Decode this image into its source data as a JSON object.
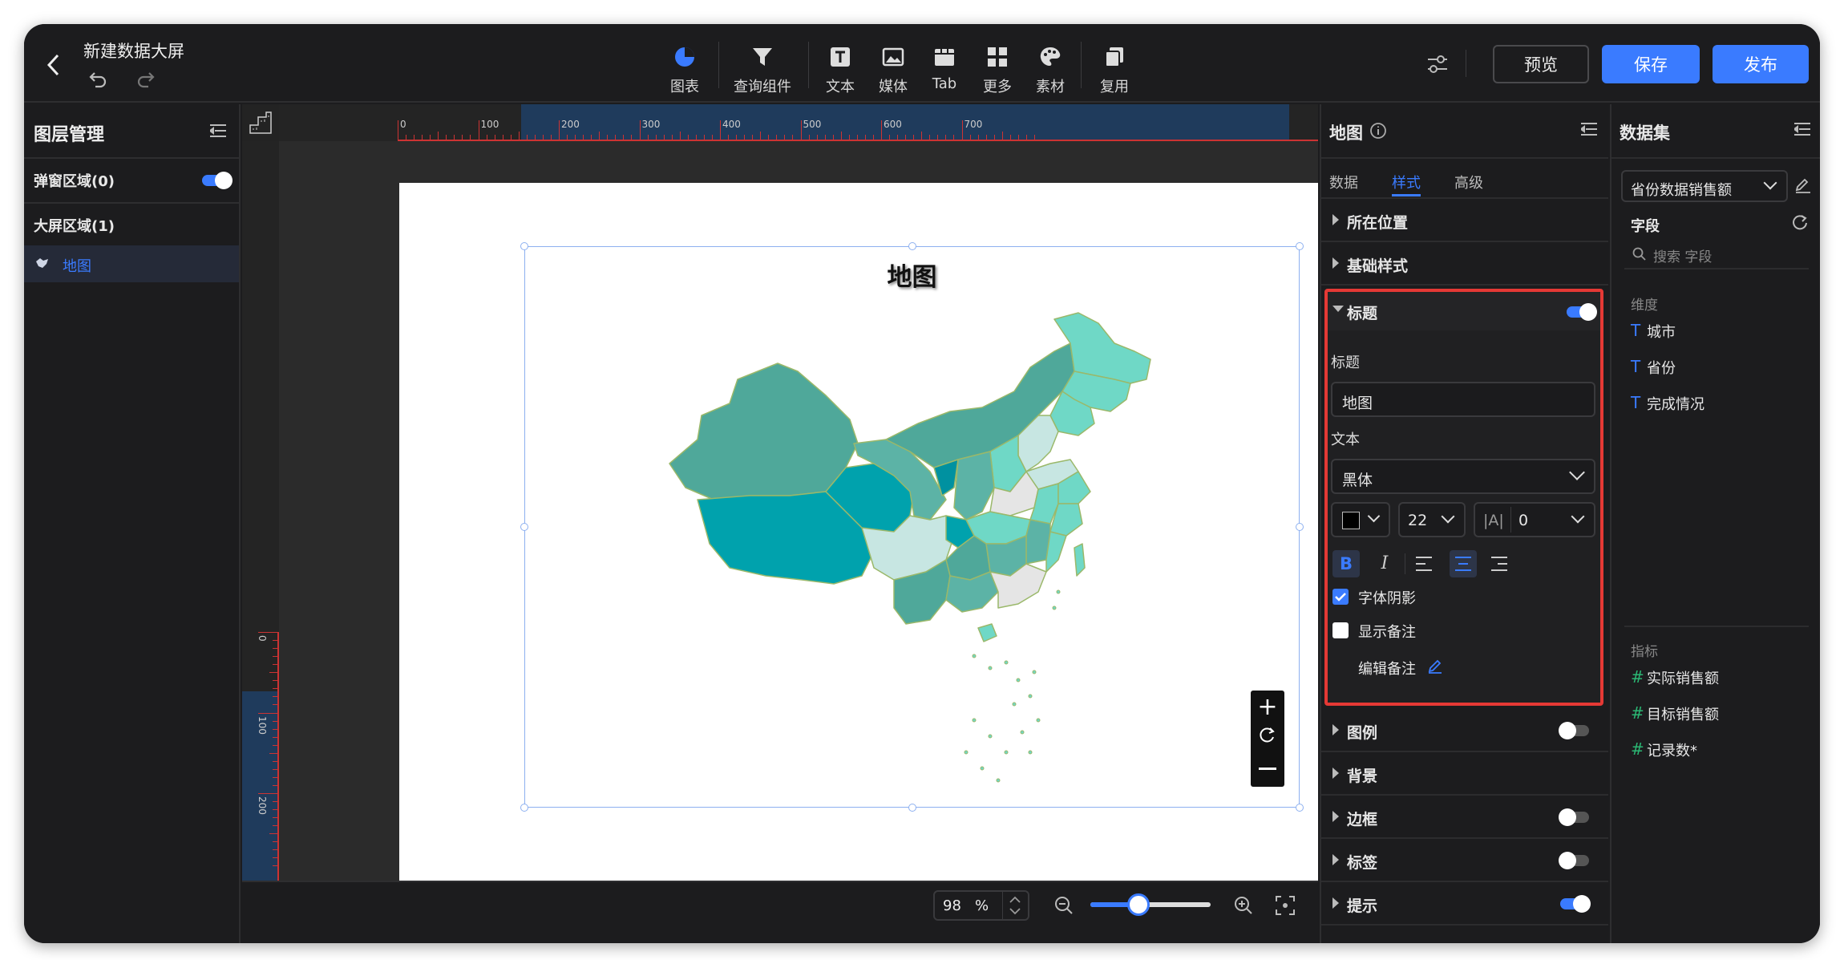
{
  "header": {
    "title": "新建数据大屏",
    "settings_icon": "sliders-icon",
    "preview_label": "预览",
    "save_label": "保存",
    "publish_label": "发布"
  },
  "toolbar": [
    {
      "label": "图表",
      "icon": "pie-chart-icon"
    },
    {
      "label": "查询组件",
      "icon": "filter-icon"
    },
    {
      "label": "文本",
      "icon": "text-icon"
    },
    {
      "label": "媒体",
      "icon": "image-icon"
    },
    {
      "label": "Tab",
      "icon": "tab-icon"
    },
    {
      "label": "更多",
      "icon": "grid-icon"
    },
    {
      "label": "素材",
      "icon": "palette-icon"
    },
    {
      "label": "复用",
      "icon": "copy-icon"
    }
  ],
  "layers": {
    "title": "图层管理",
    "popup_area": "弹窗区域(0)",
    "screen_area": "大屏区域(1)",
    "items": [
      {
        "label": "地图",
        "icon": "map-icon"
      }
    ]
  },
  "ruler": {
    "h_ticks": [
      "0",
      "100",
      "200",
      "300",
      "400",
      "500",
      "600",
      "700"
    ],
    "v_ticks": [
      "0",
      "100",
      "200"
    ]
  },
  "canvas": {
    "map_title": "地图"
  },
  "zoom": {
    "value": "98",
    "unit": "%",
    "level": 0.4
  },
  "style_panel": {
    "title": "地图",
    "tabs": [
      "数据",
      "样式",
      "高级"
    ],
    "active_tab": "样式",
    "sections_top": [
      "所在位置",
      "基础样式"
    ],
    "title_section": {
      "label": "标题",
      "enabled": true,
      "title_label": "标题",
      "title_value": "地图",
      "text_label": "文本",
      "font_value": "黑体",
      "font_size": "22",
      "letter_spacing": "0",
      "shadow_label": "字体阴影",
      "shadow_checked": true,
      "note_label": "显示备注",
      "note_checked": false,
      "edit_note_label": "编辑备注"
    },
    "sections_bottom": [
      {
        "label": "图例",
        "toggle": false
      },
      {
        "label": "背景",
        "toggle": null
      },
      {
        "label": "边框",
        "toggle": false
      },
      {
        "label": "标签",
        "toggle": false
      },
      {
        "label": "提示",
        "toggle": true
      }
    ]
  },
  "dataset": {
    "title": "数据集",
    "selected": "省份数据销售额",
    "fields_label": "字段",
    "search_placeholder": "搜索 字段",
    "dimensions_label": "维度",
    "dimensions": [
      "城市",
      "省份",
      "完成情况"
    ],
    "measures_label": "指标",
    "measures": [
      "实际销售额",
      "目标销售额",
      "记录数*"
    ]
  },
  "colors": {
    "accent": "#3a7bff",
    "highlight_border": "#e53935",
    "map_dark": "#009aa6",
    "map_mid": "#4fa89a",
    "map_light": "#6fd8c6",
    "map_pale": "#c7e6e2"
  }
}
